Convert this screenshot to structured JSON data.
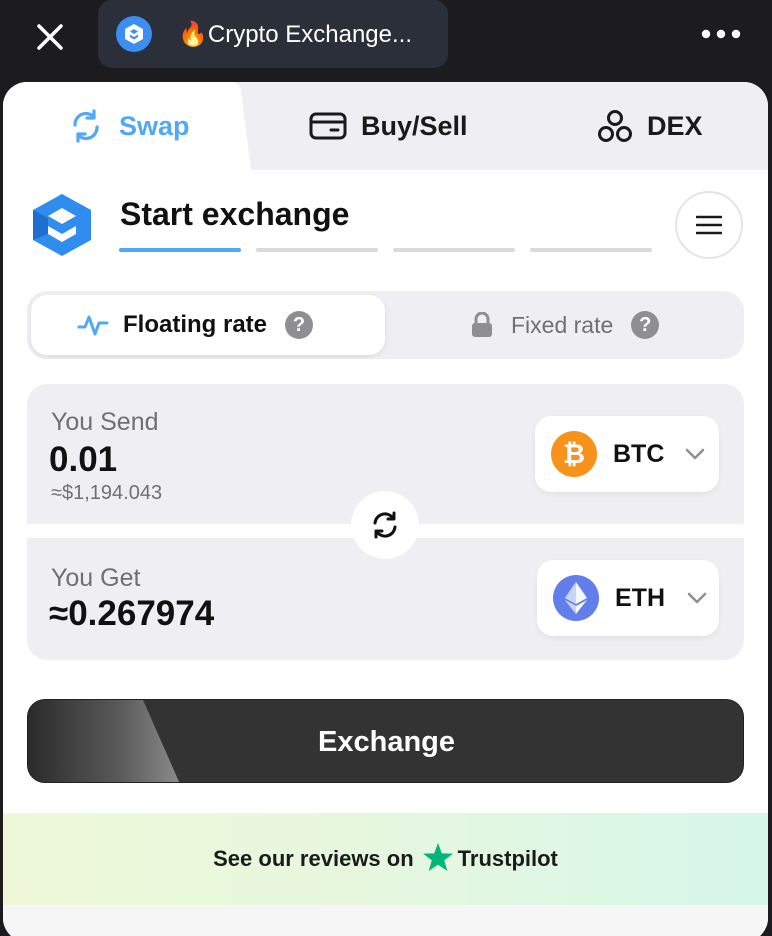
{
  "window": {
    "title": "🔥Crypto Exchange...",
    "close_icon": "close-icon",
    "more_icon": "more-horizontal-icon"
  },
  "tabs": [
    {
      "label": "Swap",
      "icon": "swap-arrows-icon",
      "active": true
    },
    {
      "label": "Buy/Sell",
      "icon": "credit-card-icon",
      "active": false
    },
    {
      "label": "DEX",
      "icon": "dex-circles-icon",
      "active": false
    }
  ],
  "header": {
    "title": "Start exchange",
    "steps_total": 4,
    "steps_active": 1
  },
  "rate": {
    "floating_label": "Floating rate",
    "fixed_label": "Fixed rate",
    "help_glyph": "?",
    "selected": "floating"
  },
  "send": {
    "label": "You Send",
    "amount": "0.01",
    "usd_estimate": "≈$1,194.043",
    "currency": "BTC",
    "currency_glyph": "₿"
  },
  "get": {
    "label": "You Get",
    "amount": "≈0.267974",
    "currency": "ETH"
  },
  "exchange_button": {
    "label": "Exchange"
  },
  "trustpilot": {
    "text": "See our reviews on",
    "brand": "Trustpilot"
  },
  "colors": {
    "accent": "#53a8f4",
    "btc": "#f7931a",
    "eth": "#627eea",
    "trustpilot_star": "#00b67a"
  }
}
